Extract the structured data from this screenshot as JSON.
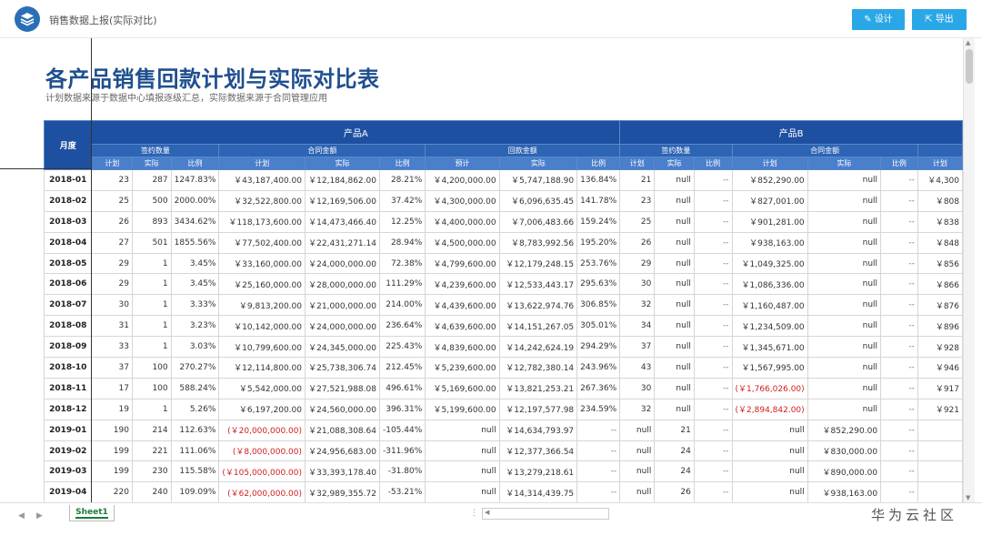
{
  "app": {
    "title": "销售数据上报(实际对比)",
    "accent": "#2aa7e6",
    "header_blue": "#1e50a2"
  },
  "toolbar": {
    "design_label": "设计",
    "export_label": "导出"
  },
  "report": {
    "title": "各产品销售回款计划与实际对比表",
    "subtitle": "计划数据来源于数据中心填报逐级汇总，实际数据来源于合同管理应用"
  },
  "table": {
    "month_header": "月度",
    "products": [
      "产品A",
      "产品B"
    ],
    "groups": [
      "签约数量",
      "合同金额",
      "回款金额",
      "签约数量",
      "合同金额"
    ],
    "cols": [
      "计划",
      "实际",
      "比例",
      "计划",
      "实际",
      "比例",
      "预计",
      "实际",
      "比例",
      "计划",
      "实际",
      "比例",
      "计划",
      "实际",
      "比例",
      "计划"
    ],
    "rows": [
      [
        "2018-01",
        "23",
        "287",
        "1247.83%",
        "￥43,187,400.00",
        "￥12,184,862.00",
        "28.21%",
        "￥4,200,000.00",
        "￥5,747,188.90",
        "136.84%",
        "21",
        "null",
        "--",
        "￥852,290.00",
        "null",
        "--",
        "￥4,300"
      ],
      [
        "2018-02",
        "25",
        "500",
        "2000.00%",
        "￥32,522,800.00",
        "￥12,169,506.00",
        "37.42%",
        "￥4,300,000.00",
        "￥6,096,635.45",
        "141.78%",
        "23",
        "null",
        "--",
        "￥827,001.00",
        "null",
        "--",
        "￥808"
      ],
      [
        "2018-03",
        "26",
        "893",
        "3434.62%",
        "￥118,173,600.00",
        "￥14,473,466.40",
        "12.25%",
        "￥4,400,000.00",
        "￥7,006,483.66",
        "159.24%",
        "25",
        "null",
        "--",
        "￥901,281.00",
        "null",
        "--",
        "￥838"
      ],
      [
        "2018-04",
        "27",
        "501",
        "1855.56%",
        "￥77,502,400.00",
        "￥22,431,271.14",
        "28.94%",
        "￥4,500,000.00",
        "￥8,783,992.56",
        "195.20%",
        "26",
        "null",
        "--",
        "￥938,163.00",
        "null",
        "--",
        "￥848"
      ],
      [
        "2018-05",
        "29",
        "1",
        "3.45%",
        "￥33,160,000.00",
        "￥24,000,000.00",
        "72.38%",
        "￥4,799,600.00",
        "￥12,179,248.15",
        "253.76%",
        "29",
        "null",
        "--",
        "￥1,049,325.00",
        "null",
        "--",
        "￥856"
      ],
      [
        "2018-06",
        "29",
        "1",
        "3.45%",
        "￥25,160,000.00",
        "￥28,000,000.00",
        "111.29%",
        "￥4,239,600.00",
        "￥12,533,443.17",
        "295.63%",
        "30",
        "null",
        "--",
        "￥1,086,336.00",
        "null",
        "--",
        "￥866"
      ],
      [
        "2018-07",
        "30",
        "1",
        "3.33%",
        "￥9,813,200.00",
        "￥21,000,000.00",
        "214.00%",
        "￥4,439,600.00",
        "￥13,622,974.76",
        "306.85%",
        "32",
        "null",
        "--",
        "￥1,160,487.00",
        "null",
        "--",
        "￥876"
      ],
      [
        "2018-08",
        "31",
        "1",
        "3.23%",
        "￥10,142,000.00",
        "￥24,000,000.00",
        "236.64%",
        "￥4,639,600.00",
        "￥14,151,267.05",
        "305.01%",
        "34",
        "null",
        "--",
        "￥1,234,509.00",
        "null",
        "--",
        "￥896"
      ],
      [
        "2018-09",
        "33",
        "1",
        "3.03%",
        "￥10,799,600.00",
        "￥24,345,000.00",
        "225.43%",
        "￥4,839,600.00",
        "￥14,242,624.19",
        "294.29%",
        "37",
        "null",
        "--",
        "￥1,345,671.00",
        "null",
        "--",
        "￥928"
      ],
      [
        "2018-10",
        "37",
        "100",
        "270.27%",
        "￥12,114,800.00",
        "￥25,738,306.74",
        "212.45%",
        "￥5,239,600.00",
        "￥12,782,380.14",
        "243.96%",
        "43",
        "null",
        "--",
        "￥1,567,995.00",
        "null",
        "--",
        "￥946"
      ],
      [
        "2018-11",
        "17",
        "100",
        "588.24%",
        "￥5,542,000.00",
        "￥27,521,988.08",
        "496.61%",
        "￥5,169,600.00",
        "￥13,821,253.21",
        "267.36%",
        "30",
        "null",
        "--",
        "(￥1,766,026.00)",
        "null",
        "--",
        "￥917"
      ],
      [
        "2018-12",
        "19",
        "1",
        "5.26%",
        "￥6,197,200.00",
        "￥24,560,000.00",
        "396.31%",
        "￥5,199,600.00",
        "￥12,197,577.98",
        "234.59%",
        "32",
        "null",
        "--",
        "(￥2,894,842.00)",
        "null",
        "--",
        "￥921"
      ],
      [
        "2019-01",
        "190",
        "214",
        "112.63%",
        "(￥20,000,000.00)",
        "￥21,088,308.64",
        "-105.44%",
        "null",
        "￥14,634,793.97",
        "--",
        "null",
        "21",
        "--",
        "null",
        "￥852,290.00",
        "--",
        ""
      ],
      [
        "2019-02",
        "199",
        "221",
        "111.06%",
        "(￥8,000,000.00)",
        "￥24,956,683.00",
        "-311.96%",
        "null",
        "￥12,377,366.54",
        "--",
        "null",
        "24",
        "--",
        "null",
        "￥830,000.00",
        "--",
        ""
      ],
      [
        "2019-03",
        "199",
        "230",
        "115.58%",
        "(￥105,000,000.00)",
        "￥33,393,178.40",
        "-31.80%",
        "null",
        "￥13,279,218.61",
        "--",
        "null",
        "24",
        "--",
        "null",
        "￥890,000.00",
        "--",
        ""
      ],
      [
        "2019-04",
        "220",
        "240",
        "109.09%",
        "(￥62,000,000.00)",
        "￥32,989,355.72",
        "-53.21%",
        "null",
        "￥14,314,439.75",
        "--",
        "null",
        "26",
        "--",
        "null",
        "￥938,163.00",
        "--",
        ""
      ]
    ]
  },
  "sheet_tab": "Sheet1",
  "watermark": "华为云社区"
}
